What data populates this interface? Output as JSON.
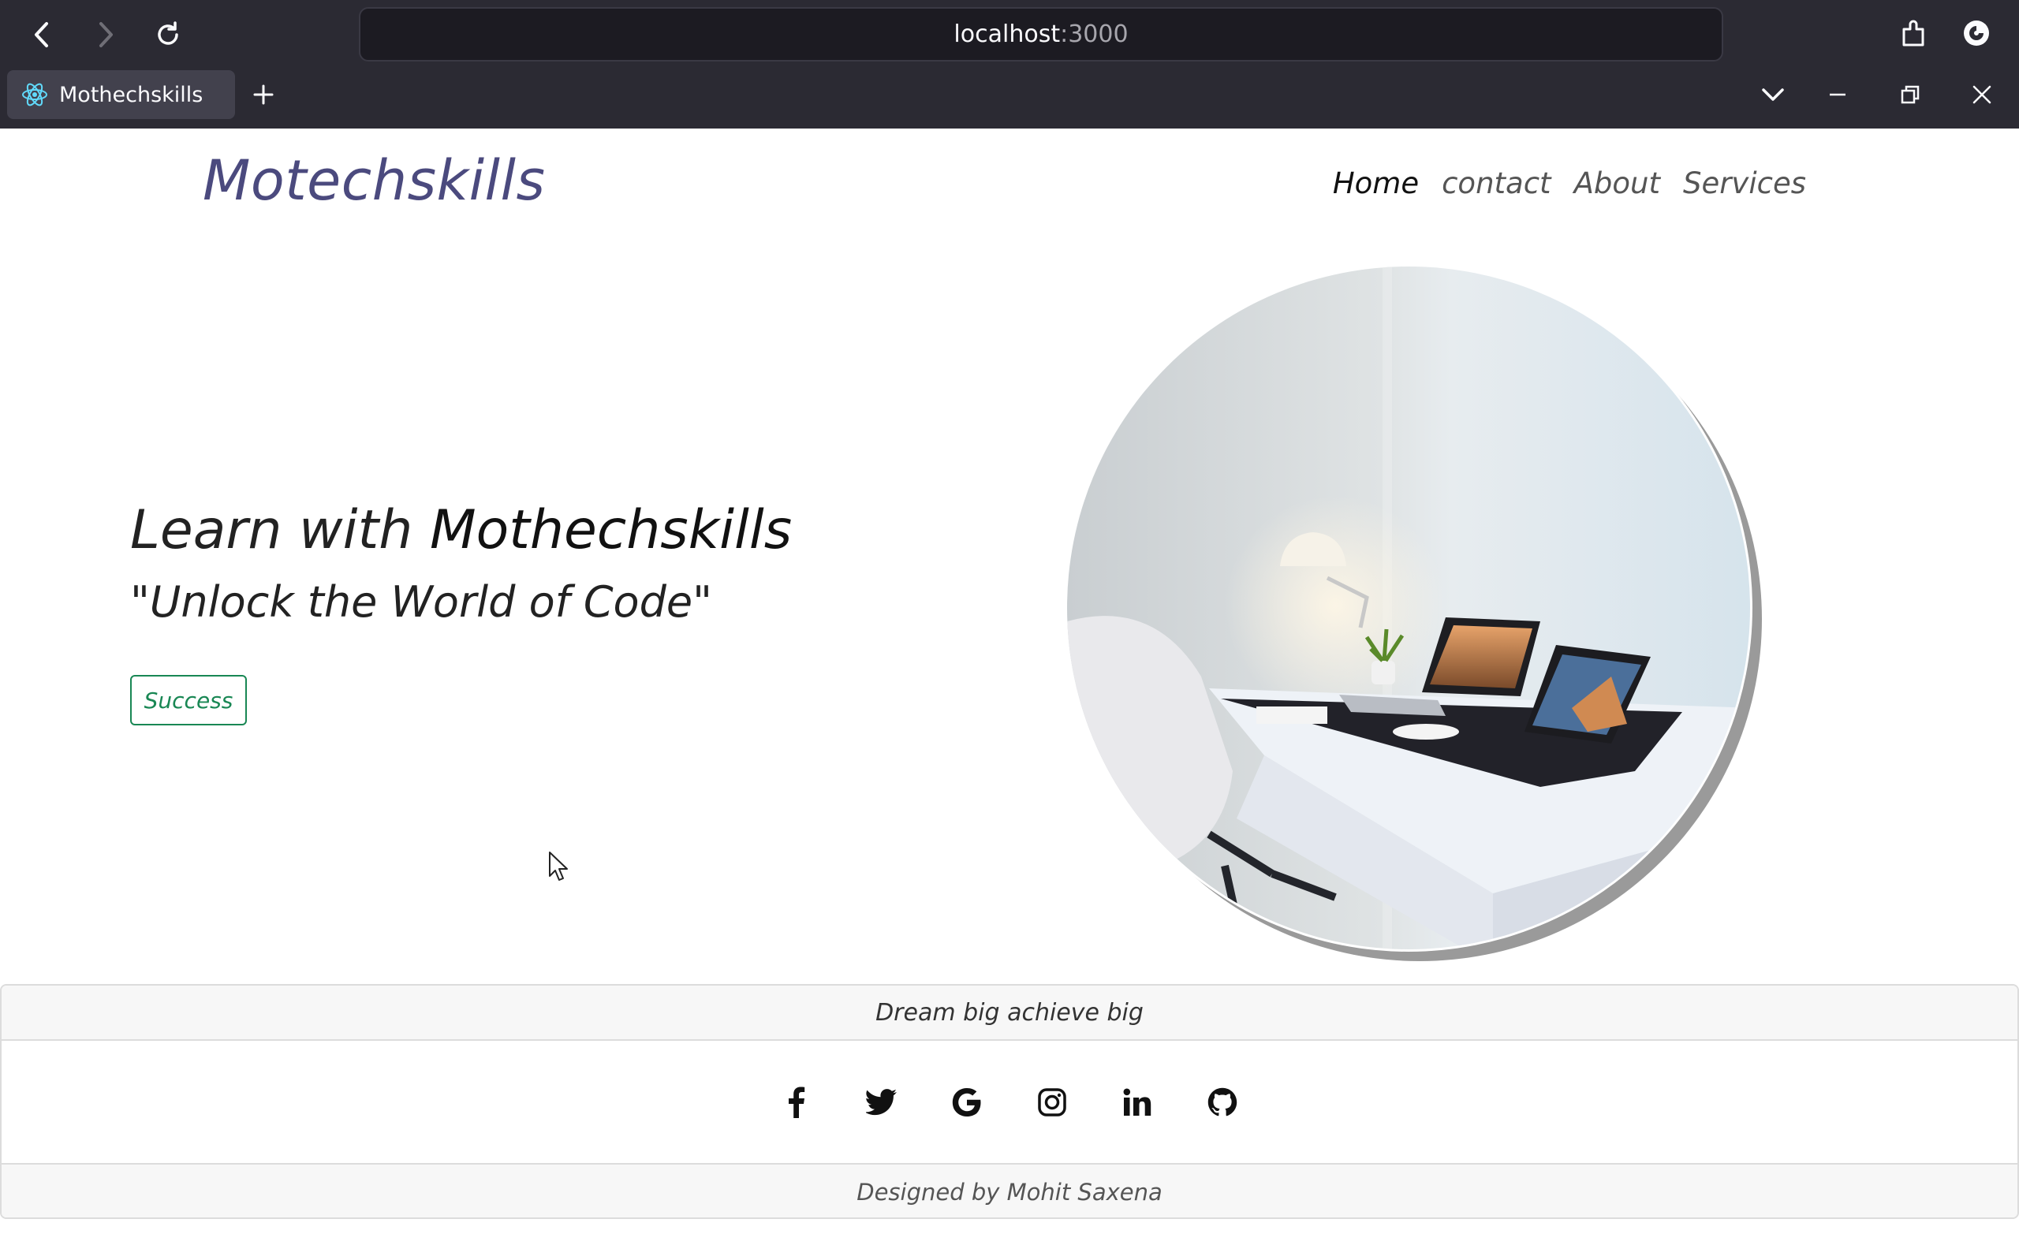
{
  "browser": {
    "url_host": "localhost",
    "url_port": ":3000",
    "tab_title": "Mothechskills",
    "new_tab_icon": "plus-icon",
    "controls": [
      "back-icon",
      "forward-icon",
      "reload-icon",
      "extensions-icon",
      "account-icon",
      "tab-list-icon",
      "minimize-icon",
      "restore-icon",
      "close-icon"
    ]
  },
  "site": {
    "brand": "Motechskills",
    "nav": {
      "home": "Home",
      "contact": "contact",
      "about": "About",
      "services": "Services"
    },
    "hero": {
      "title_prefix": "Learn with ",
      "title_brand": "Mothechskills",
      "subtitle": "\"Unlock the World of Code\"",
      "button_label": "Success"
    },
    "footer": {
      "tagline": "Dream big achieve big",
      "social_icons": [
        "facebook-icon",
        "twitter-icon",
        "google-icon",
        "instagram-icon",
        "linkedin-icon",
        "github-icon"
      ],
      "credit": "Designed by Mohit Saxena"
    }
  },
  "colors": {
    "chrome_bg": "#2b2a33",
    "brand": "#4b4a7e",
    "success": "#198754"
  }
}
